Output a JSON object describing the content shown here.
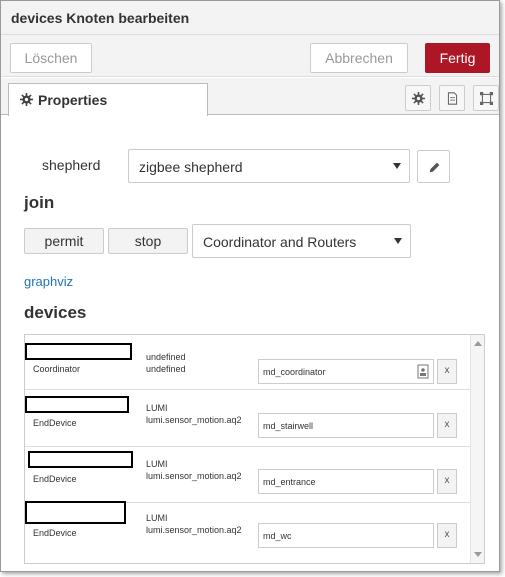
{
  "dialog": {
    "title": "devices Knoten bearbeiten",
    "delete_label": "Löschen",
    "cancel_label": "Abbrechen",
    "done_label": "Fertig"
  },
  "tabs": {
    "properties_label": "Properties"
  },
  "form": {
    "shepherd_label": "shepherd",
    "shepherd_value": "zigbee shepherd",
    "join_heading": "join",
    "permit_label": "permit",
    "stop_label": "stop",
    "join_mode_value": "Coordinator and Routers",
    "graphviz_link": "graphviz",
    "devices_heading": "devices"
  },
  "devices": [
    {
      "type": "Coordinator",
      "manufacturer": "undefined",
      "model": "undefined",
      "name": "md_coordinator",
      "delete": "x"
    },
    {
      "type": "EndDevice",
      "manufacturer": "LUMI",
      "model": "lumi.sensor_motion.aq2",
      "name": "md_stairwell",
      "delete": "x"
    },
    {
      "type": "EndDevice",
      "manufacturer": "LUMI",
      "model": "lumi.sensor_motion.aq2",
      "name": "md_entrance",
      "delete": "x"
    },
    {
      "type": "EndDevice",
      "manufacturer": "LUMI",
      "model": "lumi.sensor_motion.aq2",
      "name": "md_wc",
      "delete": "x"
    }
  ],
  "colors": {
    "primary_button": "#ad1625",
    "link": "#2273b7"
  }
}
